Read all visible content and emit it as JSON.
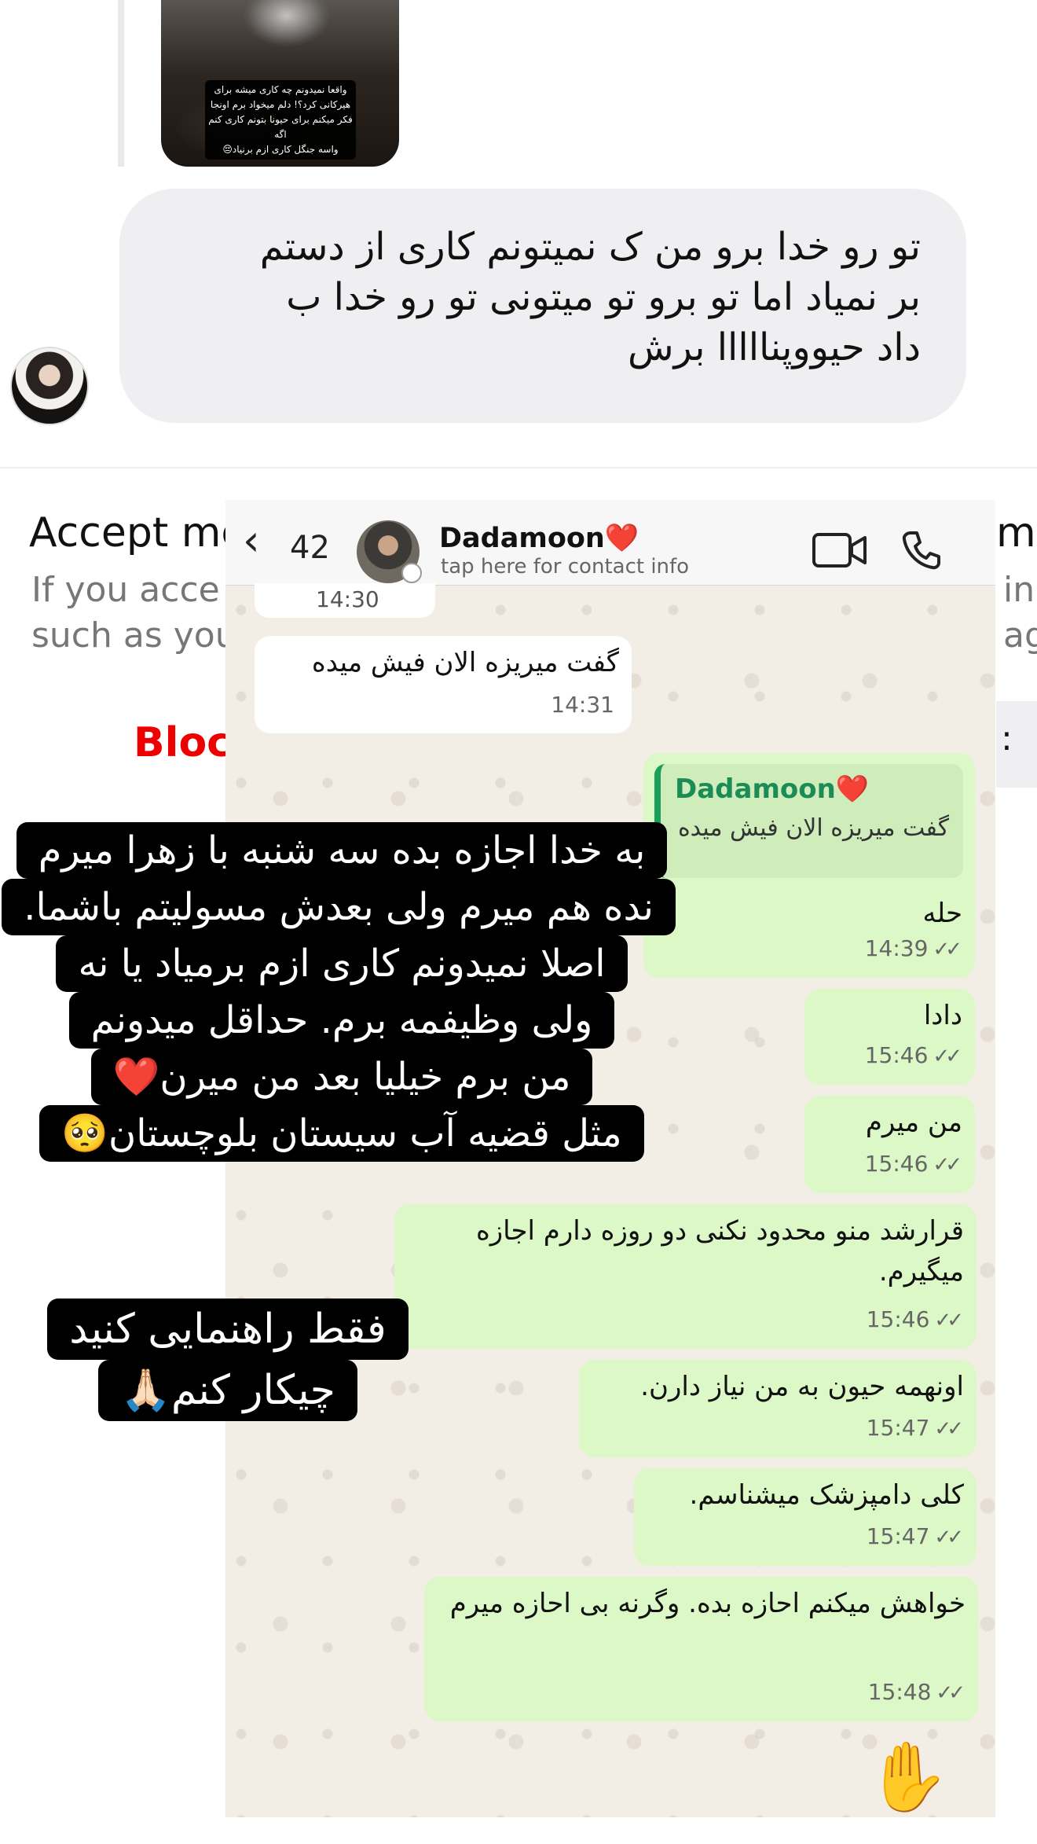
{
  "instagram": {
    "shared_image_caption": [
      "واقعا نمیدونم چه کاری میشه برای",
      "هیرکانی کرد؟! دلم میخواد برم اونجا",
      "فکر میکنم برای حیونا بتونم کاری کنم اگه",
      "واسه جنگل کاری ازم برنیاد😔"
    ],
    "message_lines": [
      "تو رو خدا برو من ک نمیتونم کاری از دستم",
      "بر نمیاد اما تو برو تو میتونی تو رو خدا ب",
      "داد حیووپنااااا برش"
    ],
    "accept_title_visible": "Accept me",
    "accept_title_tail": "me",
    "accept_desc_visible": "If you acce\nsuch as you",
    "accept_desc_tail": "in\nag",
    "block_label": "Block",
    "right_button_visible": ":"
  },
  "whatsapp": {
    "back_count": "42",
    "contact_name": "Dadamoon❤️",
    "contact_subtitle": "tap here for contact info",
    "first_partial_time": "14:30",
    "messages": [
      {
        "dir": "in",
        "text": "گفت میریزه الان فیش میده",
        "time": "14:31"
      },
      {
        "dir": "out",
        "quote_name": "Dadamoon❤️",
        "quote_text": "گفت میریزه الان فیش میده",
        "text": "حله",
        "time": "14:39"
      },
      {
        "dir": "out",
        "text": "دادا",
        "time": "15:46"
      },
      {
        "dir": "out",
        "text": "من میرم",
        "time": "15:46"
      },
      {
        "dir": "out",
        "text": "قرارشد منو محدود نکنی دو روزه دارم اجازه میگیرم.",
        "time": "15:46"
      },
      {
        "dir": "out",
        "text": "اونهمه حیون به من نیاز دارن.",
        "time": "15:47"
      },
      {
        "dir": "out",
        "text": "کلی دامپزشک میشناسم.",
        "time": "15:47"
      },
      {
        "dir": "out",
        "text": "خواهش میکنم احازه بده. وگرنه بی احازه میرم",
        "time": "15:48"
      }
    ],
    "read_ticks": "✓✓",
    "hand_emoji": "✋"
  },
  "overlays": {
    "story_text_1": [
      "به خدا اجازه بده سه شنبه با زهرا میرم",
      "نده هم میرم ولی بعدش مسولیتم باشما.",
      "اصلا نمیدونم کاری ازم برمیاد یا نه",
      "ولی وظیفمه برم. حداقل میدونم",
      "من برم خیلیا بعد من میرن❤️",
      "مثل قضیه آب سیستان بلوچستان🥺"
    ],
    "story_text_2": [
      "فقط راهنمایی کنید",
      "چیکار کنم🙏🏻"
    ]
  },
  "colors": {
    "block_red": "#ed0000",
    "wa_outgoing": "#dcf8c6",
    "wa_quote_green": "#1b8c55",
    "ig_bubble": "#efeff1"
  },
  "icons": [
    "chevron-left-icon",
    "video-call-icon",
    "phone-icon",
    "double-check-icon",
    "status-ring-icon"
  ]
}
